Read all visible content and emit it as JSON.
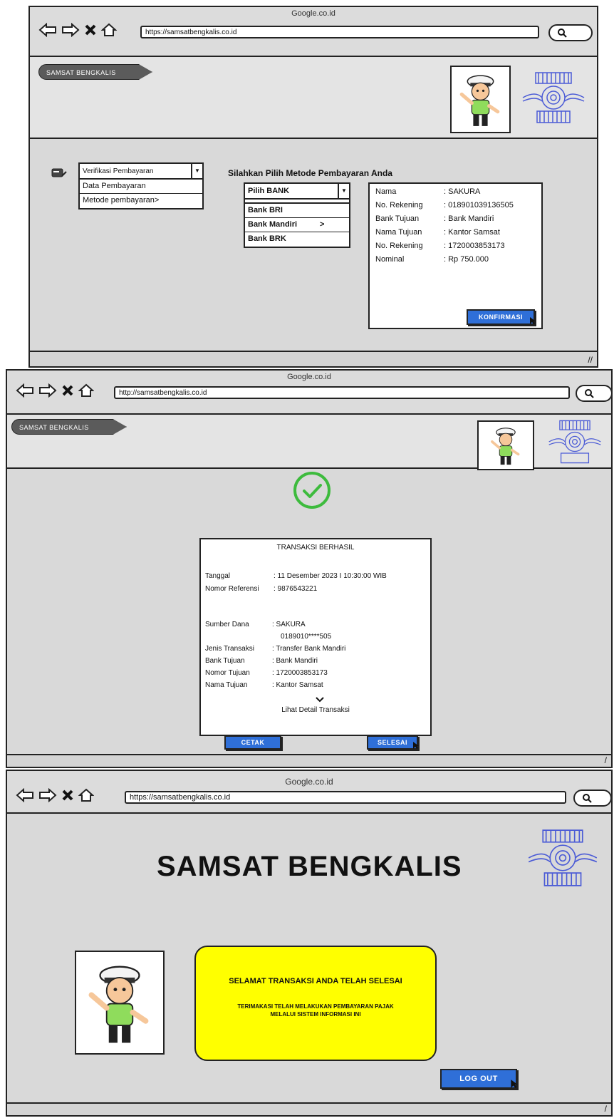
{
  "screen1": {
    "browser_title": "Google.co.id",
    "url": "https://samsatbengkalis.co.id",
    "brand_tab": "SAMSAT BENGKALIS",
    "menu": {
      "selected": "Verifikasi Pembayaran",
      "items": [
        "Data Pembayaran",
        "Metode pembayaran>"
      ]
    },
    "heading": "Silahkan Pilih Metode Pembayaran Anda",
    "bank_select": {
      "selected": "Pilih BANK",
      "options": [
        "Bank BRI",
        "Bank Mandiri",
        "Bank BRK"
      ],
      "active_marker": ">"
    },
    "details": [
      {
        "label": "Nama",
        "value": ": SAKURA"
      },
      {
        "label": "No. Rekening",
        "value": ": 018901039136505"
      },
      {
        "label": "Bank Tujuan",
        "value": ": Bank Mandiri"
      },
      {
        "label": "Nama Tujuan",
        "value": ": Kantor Samsat"
      },
      {
        "label": "No. Rekening",
        "value": ": 1720003853173"
      },
      {
        "label": "Nominal",
        "value": ": Rp 750.000"
      }
    ],
    "confirm_button": "KONFIRMASI"
  },
  "screen2": {
    "browser_title": "Google.co.id",
    "url": "http://samsatbengkalis.co.id",
    "brand_tab": "SAMSAT BENGKALIS",
    "receipt_title": "TRANSAKSI BERHASIL",
    "tanggal_label": "Tanggal",
    "tanggal_value": ": 11 Desember 2023 I 10:30:00 WIB",
    "ref_label": "Nomor Referensi",
    "ref_value": ": 9876543221",
    "rows": [
      {
        "label": "Sumber Dana",
        "value": ": SAKURA"
      },
      {
        "label": "",
        "value": "0189010****505"
      },
      {
        "label": "Jenis Transaksi",
        "value": ": Transfer Bank Mandiri"
      },
      {
        "label": "Bank Tujuan",
        "value": ": Bank Mandiri"
      },
      {
        "label": "Nomor Tujuan",
        "value": ": 1720003853173"
      },
      {
        "label": "Nama Tujuan",
        "value": ": Kantor Samsat"
      }
    ],
    "detail_link": "Lihat Detail Transaksi",
    "print_button": "CETAK",
    "done_button": "SELESAI"
  },
  "screen3": {
    "browser_title": "Google.co.id",
    "url": "https://samsatbengkalis.co.id",
    "big_title": "SAMSAT BENGKALIS",
    "message_title": "SELAMAT TRANSAKSI ANDA TELAH SELESAI",
    "message_body": "TERIMAKASI TELAH MELAKUKAN PEMBAYARAN PAJAK MELALUI SISTEM INFORMASI INI",
    "logout_button": "LOG OUT"
  },
  "colors": {
    "window_bg": "#d9d9d9",
    "button_blue": "#2f6fd8",
    "message_yellow": "#ffff00",
    "success_green": "#3dbb3d",
    "emblem_blue": "#4b5bd6"
  },
  "icons": [
    "back-arrow-icon",
    "forward-arrow-icon",
    "close-icon",
    "home-icon",
    "search-icon",
    "checkmark-circle-icon",
    "chevron-down-icon",
    "cursor-icon",
    "payment-icon",
    "resize-grip-icon"
  ]
}
